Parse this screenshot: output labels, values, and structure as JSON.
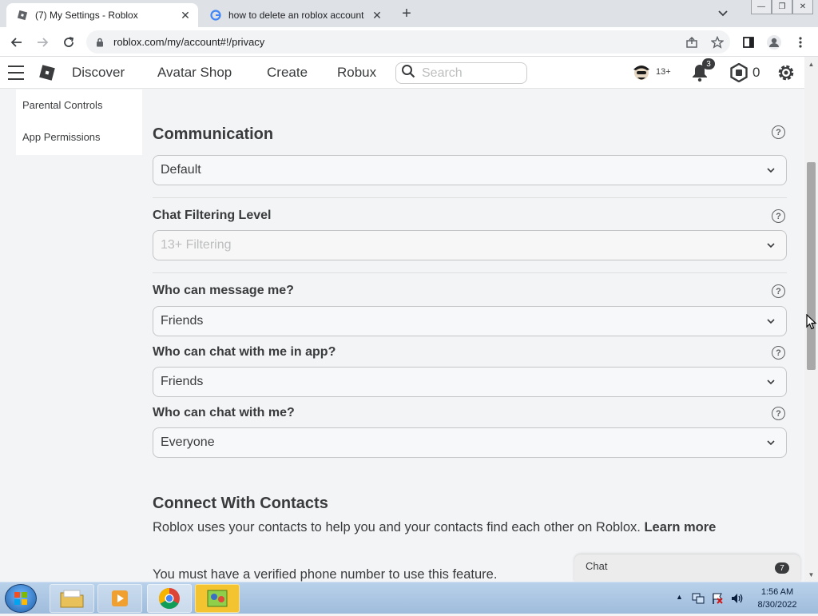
{
  "browser": {
    "tabs": [
      {
        "title": "(7) My Settings - Roblox",
        "active": true
      },
      {
        "title": "how to delete an roblox account",
        "active": false
      }
    ],
    "url": "roblox.com/my/account#!/privacy"
  },
  "header": {
    "nav": [
      "Discover",
      "Avatar Shop",
      "Create",
      "Robux"
    ],
    "search_placeholder": "Search",
    "age_label": "13+",
    "notification_count": "3",
    "robux_balance": "0"
  },
  "sidebar": {
    "items": [
      "Parental Controls",
      "App Permissions"
    ]
  },
  "communication": {
    "title": "Communication",
    "setting_value": "Default",
    "chat_filter_label": "Chat Filtering Level",
    "chat_filter_value": "13+ Filtering",
    "message_label": "Who can message me?",
    "message_value": "Friends",
    "chat_app_label": "Who can chat with me in app?",
    "chat_app_value": "Friends",
    "chat_label": "Who can chat with me?",
    "chat_value": "Everyone"
  },
  "contacts": {
    "title": "Connect With Contacts",
    "description": "Roblox uses your contacts to help you and your contacts find each other on Roblox.",
    "learn_more": "Learn more",
    "note": "You must have a verified phone number to use this feature."
  },
  "chat_widget": {
    "label": "Chat",
    "count": "7"
  },
  "taskbar": {
    "time": "1:56 AM",
    "date": "8/30/2022"
  },
  "colors": {
    "accent": "#393b3d",
    "page_bg": "#f2f4f5",
    "tabstrip_bg": "#dee1e6"
  }
}
